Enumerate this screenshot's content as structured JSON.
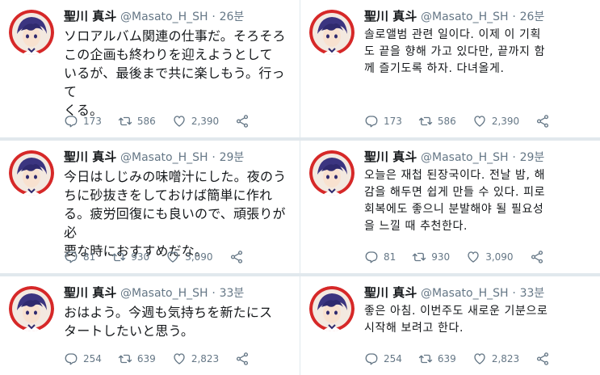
{
  "tweets": [
    {
      "name": "聖川 真斗",
      "handle": "@Masato_H_SH",
      "separator": "·",
      "time": "26분",
      "text": "ソロアルバム関連の仕事だ。そろそろ\nこの企画も終わりを迎えようとして\nいるが、最後まで共に楽しもう。行って\nくる。",
      "replies": "173",
      "retweets": "586",
      "likes": "2,390"
    },
    {
      "name": "聖川 真斗",
      "handle": "@Masato_H_SH",
      "separator": "·",
      "time": "26분",
      "text": "솔로앨범 관련 일이다. 이제 이 기획\n도 끝을 향해 가고 있다만, 끝까지 함\n께 즐기도록 하자. 다녀올게.",
      "replies": "173",
      "retweets": "586",
      "likes": "2,390"
    },
    {
      "name": "聖川 真斗",
      "handle": "@Masato_H_SH",
      "separator": "·",
      "time": "29분",
      "text": "今日はしじみの味噌汁にした。夜のう\nちに砂抜きをしておけば簡単に作れ\nる。疲労回復にも良いので、頑張りが必\n要な時におすすめだな。",
      "replies": "81",
      "retweets": "930",
      "likes": "3,090"
    },
    {
      "name": "聖川 真斗",
      "handle": "@Masato_H_SH",
      "separator": "·",
      "time": "29분",
      "text": "오늘은 재첩 된장국이다. 전날 밤, 해\n감을 해두면 쉽게 만들 수 있다. 피로\n회복에도 좋으니 분발해야 될 필요성\n을 느낄 때 추천한다.",
      "replies": "81",
      "retweets": "930",
      "likes": "3,090"
    },
    {
      "name": "聖川 真斗",
      "handle": "@Masato_H_SH",
      "separator": "·",
      "time": "33분",
      "text": "おはよう。今週も気持ちを新たにス\nタートしたいと思う。",
      "replies": "254",
      "retweets": "639",
      "likes": "2,823"
    },
    {
      "name": "聖川 真斗",
      "handle": "@Masato_H_SH",
      "separator": "·",
      "time": "33분",
      "text": "좋은 아침. 이번주도 새로운 기분으로\n시작해 보려고 한다.",
      "replies": "254",
      "retweets": "639",
      "likes": "2,823"
    }
  ],
  "icons": {
    "reply": "reply-icon",
    "retweet": "retweet-icon",
    "like": "heart-icon",
    "share": "share-icon"
  },
  "colors": {
    "text": "#14171a",
    "secondary": "#657786",
    "avatar_bg": "#d62828",
    "hair": "#2f2a6e",
    "separator": "#e1e8ed"
  }
}
